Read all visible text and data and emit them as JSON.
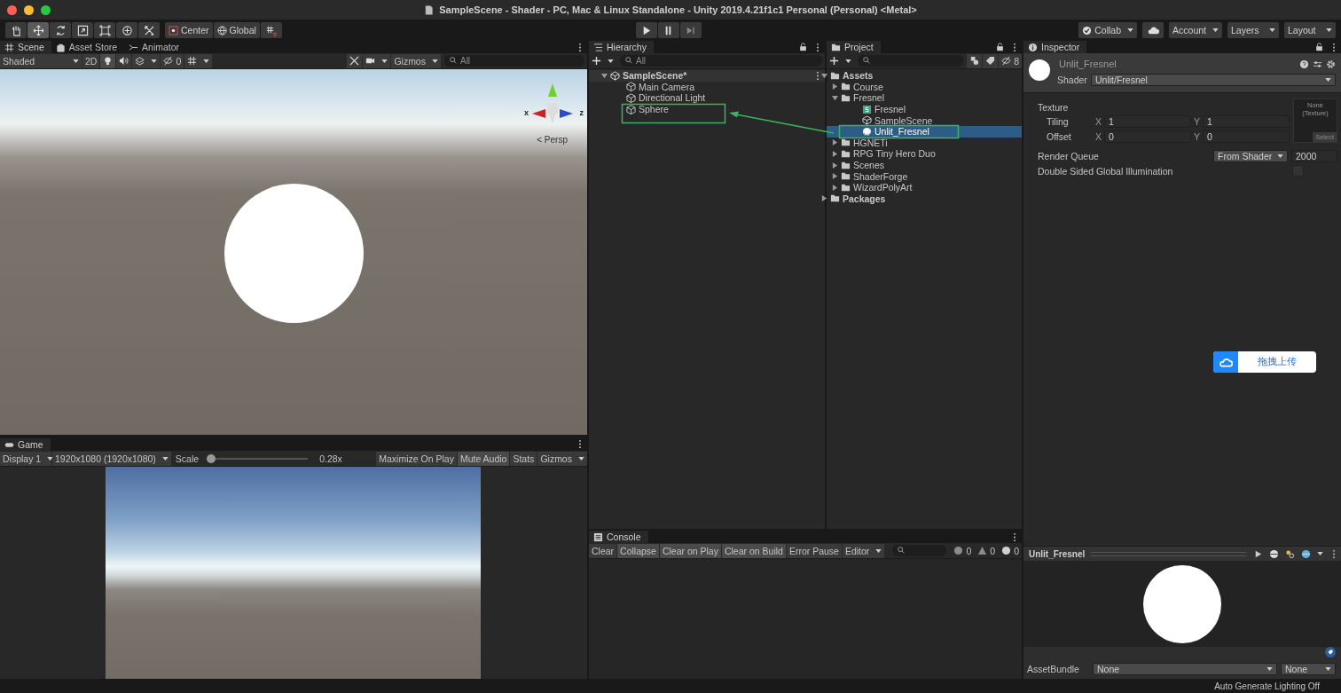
{
  "window": {
    "title": "SampleScene - Shader - PC, Mac & Linux Standalone - Unity 2019.4.21f1c1 Personal (Personal) <Metal>"
  },
  "toolbar": {
    "tools": [
      {
        "kind": "hand",
        "selected": false
      },
      {
        "kind": "move",
        "selected": true
      },
      {
        "kind": "rotate",
        "selected": false
      },
      {
        "kind": "scale",
        "selected": false
      },
      {
        "kind": "rect",
        "selected": false
      },
      {
        "kind": "transform",
        "selected": false
      },
      {
        "kind": "custom",
        "selected": false
      }
    ],
    "pivot": "Center",
    "space": "Global",
    "collab": "Collab",
    "account": "Account",
    "layers": "Layers",
    "layout": "Layout"
  },
  "scene_panel": {
    "tabs": [
      {
        "label": "Scene",
        "kind": "scene",
        "selected": true
      },
      {
        "label": "Asset Store",
        "kind": "store",
        "selected": false
      },
      {
        "label": "Animator",
        "kind": "animator",
        "selected": false
      }
    ],
    "draw_mode": "Shaded",
    "mode_2d": "2D",
    "hidden_count": "0",
    "gizmos": "Gizmos",
    "search_placeholder": "All",
    "axis_labels": [
      "x",
      "z"
    ],
    "persp_label": "< Persp"
  },
  "game_panel": {
    "tab": "Game",
    "display": "Display 1",
    "resolution": "1920x1080 (1920x1080)",
    "scale_label": "Scale",
    "scale": {
      "level": 0.0
    },
    "scale_reading": "0.28x",
    "toggles": [
      {
        "label": "Maximize On Play",
        "on": false
      },
      {
        "label": "Mute Audio",
        "on": true
      },
      {
        "label": "Stats",
        "on": false
      }
    ],
    "gizmos": "Gizmos"
  },
  "hierarchy": {
    "tab": "Hierarchy",
    "search_placeholder": "All",
    "tree": [
      {
        "label": "SampleScene*",
        "kind": "scene_root",
        "expanded": true,
        "selected": false,
        "children": [
          {
            "label": "Main Camera",
            "kind": "object",
            "selected": false
          },
          {
            "label": "Directional Light",
            "kind": "object",
            "selected": false
          },
          {
            "label": "Sphere",
            "kind": "object",
            "selected": false
          }
        ]
      }
    ]
  },
  "project": {
    "tab": "Project",
    "hidden_count": "8",
    "tree": [
      {
        "label": "Assets",
        "kind": "root",
        "expanded": true,
        "selected": false,
        "children": [
          {
            "label": "Course",
            "kind": "folder",
            "expanded": false,
            "selected": false
          },
          {
            "label": "Fresnel",
            "kind": "folder",
            "expanded": true,
            "selected": false,
            "children": [
              {
                "label": "Fresnel",
                "kind": "shader",
                "selected": false
              },
              {
                "label": "SampleScene",
                "kind": "scene",
                "selected": false
              },
              {
                "label": "Unlit_Fresnel",
                "kind": "material",
                "selected": true
              }
            ]
          },
          {
            "label": "HGNETi",
            "kind": "folder",
            "expanded": false,
            "selected": false
          },
          {
            "label": "RPG Tiny Hero Duo",
            "kind": "folder",
            "expanded": false,
            "selected": false
          },
          {
            "label": "Scenes",
            "kind": "folder",
            "expanded": false,
            "selected": false
          },
          {
            "label": "ShaderForge",
            "kind": "folder",
            "expanded": false,
            "selected": false
          },
          {
            "label": "WizardPolyArt",
            "kind": "folder",
            "expanded": false,
            "selected": false
          }
        ]
      },
      {
        "label": "Packages",
        "kind": "root",
        "expanded": false,
        "selected": false
      }
    ]
  },
  "inspector": {
    "tab": "Inspector",
    "material_name": "Unlit_Fresnel",
    "shader_label": "Shader",
    "shader": "Unlit/Fresnel",
    "texture_label": "Texture",
    "vectors": [
      {
        "label": "Tiling",
        "fields": [
          {
            "axis": "X",
            "value": "1"
          },
          {
            "axis": "Y",
            "value": "1"
          }
        ]
      },
      {
        "label": "Offset",
        "fields": [
          {
            "axis": "X",
            "value": "0"
          },
          {
            "axis": "Y",
            "value": "0"
          }
        ]
      }
    ],
    "texture_slot": {
      "value": "None (Texture)",
      "button": "Select"
    },
    "render_queue": {
      "label": "Render Queue",
      "mode": "From Shader",
      "value": "2000"
    },
    "double_sided": {
      "label": "Double Sided Global Illumination",
      "checked": false
    },
    "preview_title": "Unlit_Fresnel",
    "asset_bundle": {
      "label": "AssetBundle",
      "name": "None",
      "variant": "None"
    }
  },
  "console": {
    "tab": "Console",
    "buttons": [
      {
        "label": "Clear",
        "on": false
      },
      {
        "label": "Collapse",
        "on": true
      },
      {
        "label": "Clear on Play",
        "on": true
      },
      {
        "label": "Clear on Build",
        "on": true
      },
      {
        "label": "Error Pause",
        "on": false
      }
    ],
    "editor": "Editor",
    "counts": [
      {
        "kind": "info",
        "count": "0"
      },
      {
        "kind": "warning",
        "count": "0"
      },
      {
        "kind": "error",
        "count": "0"
      }
    ]
  },
  "upload_widget": {
    "label": "拖拽上传"
  },
  "status_bar": {
    "text": "Auto Generate Lighting Off"
  }
}
